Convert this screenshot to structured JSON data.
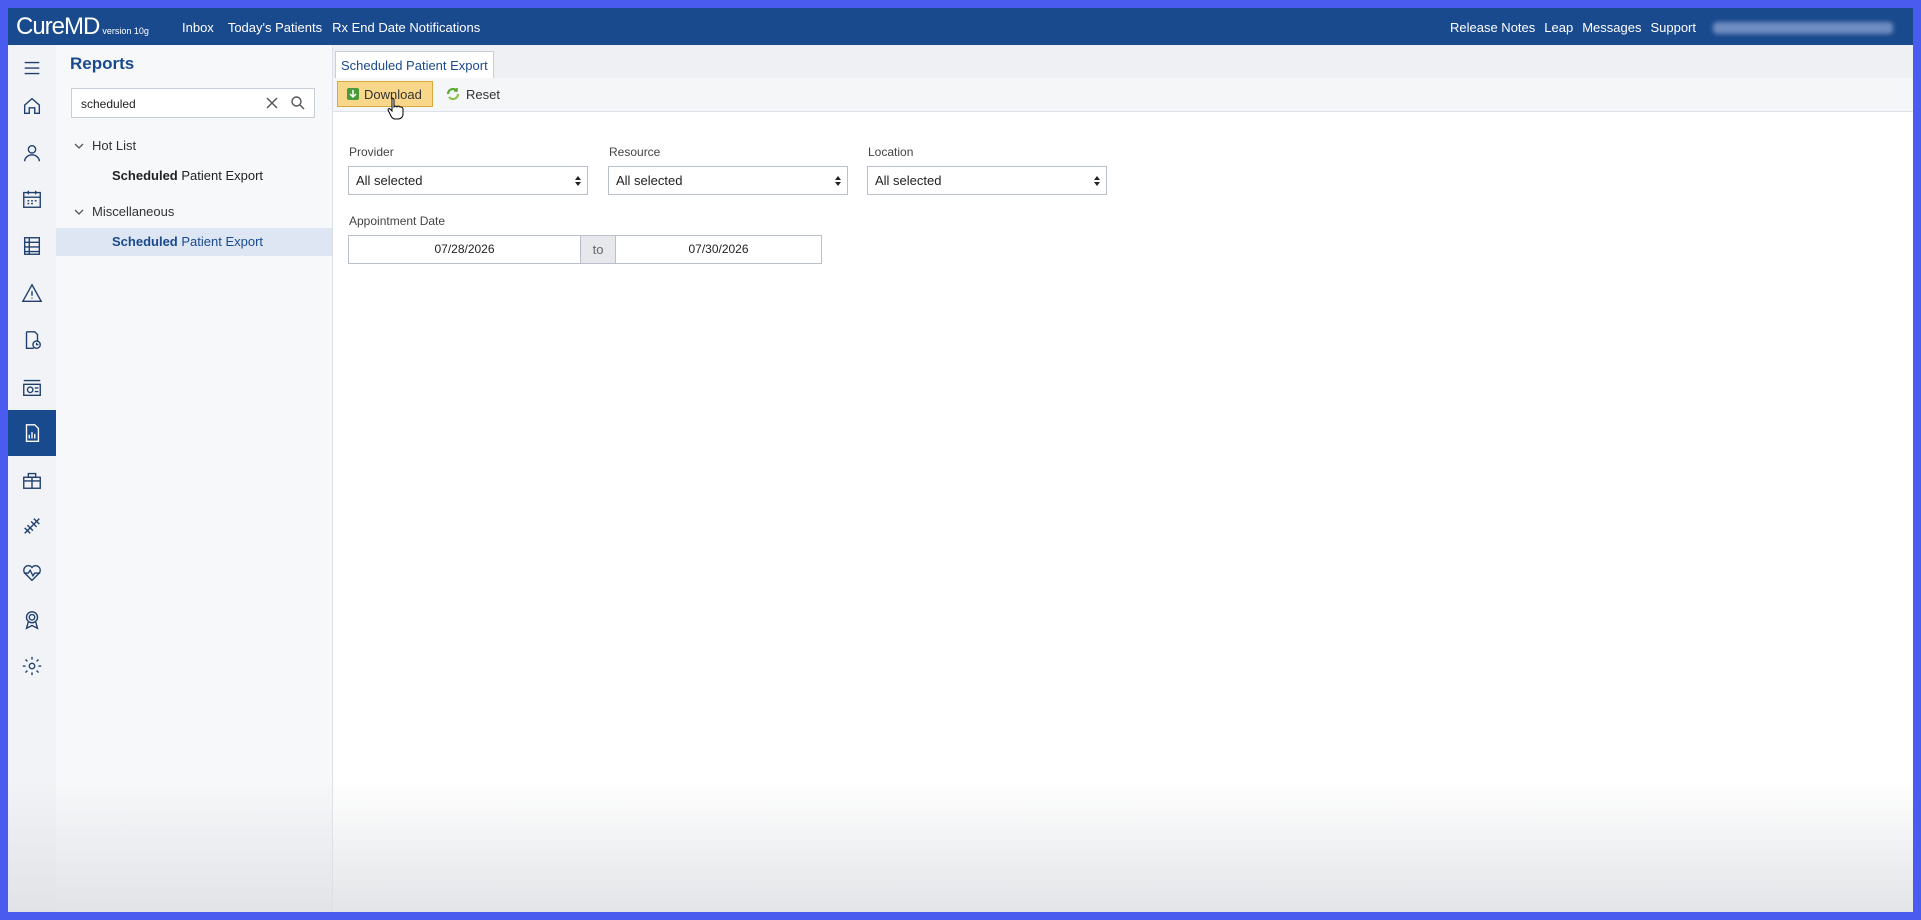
{
  "app": {
    "logo_text": "CureMD",
    "version_text": "version 10g"
  },
  "topnav": {
    "inbox": "Inbox",
    "todays_patients": "Today's Patients",
    "rx_end_date": "Rx End Date Notifications"
  },
  "rightnav": {
    "release_notes": "Release Notes",
    "leap": "Leap",
    "messages": "Messages",
    "support": "Support"
  },
  "rail_icons": [
    "menu-icon",
    "home-icon",
    "user-icon",
    "calendar-icon",
    "table-icon",
    "alert-icon",
    "billing-doc-icon",
    "payment-icon",
    "reports-icon",
    "gift-icon",
    "dna-icon",
    "health-icon",
    "award-icon",
    "settings-icon"
  ],
  "sidepanel": {
    "title": "Reports",
    "search_value": "scheduled",
    "groups": [
      {
        "label": "Hot List",
        "item_bold": "Scheduled",
        "item_rest": " Patient Export"
      },
      {
        "label": "Miscellaneous",
        "item_bold": "Scheduled",
        "item_rest": " Patient Export"
      }
    ]
  },
  "main": {
    "tab_label": "Scheduled Patient Export",
    "download_label": "Download",
    "reset_label": "Reset",
    "provider_label": "Provider",
    "provider_value": "All selected",
    "resource_label": "Resource",
    "resource_value": "All selected",
    "location_label": "Location",
    "location_value": "All selected",
    "appt_date_label": "Appointment Date",
    "date_from": "07/28/2026",
    "date_to_sep": "to",
    "date_to": "07/30/2026"
  },
  "colors": {
    "header_bg": "#1a4a8e",
    "frame": "#4a5cf0",
    "download_bg": "#f8d78a"
  }
}
